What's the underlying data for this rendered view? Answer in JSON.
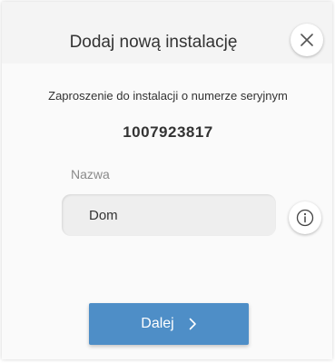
{
  "dialog": {
    "title": "Dodaj nową instalację",
    "close_icon": "close-icon",
    "invite_text": "Zaproszenie do instalacji o numerze seryjnym",
    "serial_number": "1007923817",
    "name_label": "Nazwa",
    "name_value": "Dom",
    "info_icon": "info-icon",
    "next_label": "Dalej",
    "next_icon": "chevron-right-icon"
  },
  "colors": {
    "accent": "#4e8ec7",
    "header_bg": "#f4f4f4",
    "input_bg": "#eeeeee"
  }
}
